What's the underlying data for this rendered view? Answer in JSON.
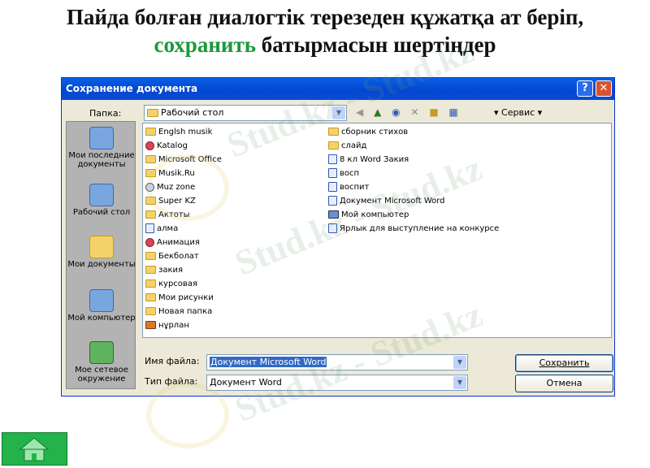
{
  "slide": {
    "title_line1": "Пайда болған диалогтік терезеден құжатқа ат беріп,",
    "title_keyword": "сохранить",
    "title_line2_rest": " батырмасын шертіңдер"
  },
  "watermark": {
    "text": "Stud.kz - Stud.kz"
  },
  "dialog": {
    "title": "Сохранение документа",
    "help_glyph": "?",
    "close_glyph": "✕",
    "folder_label": "Папка:",
    "folder_value": "Рабочий стол",
    "tools_label": "Сервис",
    "places": [
      {
        "label": "Мои последние документы"
      },
      {
        "label": "Рабочий стол"
      },
      {
        "label": "Мои документы"
      },
      {
        "label": "Мой компьютер"
      },
      {
        "label": "Мое сетевое окружение"
      }
    ],
    "files_left": [
      {
        "name": "Englsh musik",
        "icon": "folder-icon"
      },
      {
        "name": "Katalog",
        "icon": "app-icon"
      },
      {
        "name": "Microsoft Office",
        "icon": "folder-icon"
      },
      {
        "name": "Musik.Ru",
        "icon": "folder-icon"
      },
      {
        "name": "Muz zone",
        "icon": "cd-icon"
      },
      {
        "name": "Super KZ",
        "icon": "folder-icon"
      },
      {
        "name": "Актоты",
        "icon": "folder-icon"
      },
      {
        "name": "алма",
        "icon": "shortcut-icon"
      },
      {
        "name": "Анимация",
        "icon": "app-icon"
      },
      {
        "name": "Бекболат",
        "icon": "folder-icon"
      },
      {
        "name": "закия",
        "icon": "folder-icon"
      },
      {
        "name": "курсовая",
        "icon": "folder-icon"
      },
      {
        "name": "Мои рисунки",
        "icon": "folder-icon"
      },
      {
        "name": "Новая папка",
        "icon": "folder-icon"
      },
      {
        "name": "нұрлан",
        "icon": "box-icon"
      }
    ],
    "files_right": [
      {
        "name": "сборник стихов",
        "icon": "folder-icon"
      },
      {
        "name": "слайд",
        "icon": "folder-icon"
      },
      {
        "name": "8 кл Word Закия",
        "icon": "word-doc-icon"
      },
      {
        "name": "восп",
        "icon": "word-doc-icon"
      },
      {
        "name": "воспит",
        "icon": "word-doc-icon"
      },
      {
        "name": "Документ Microsoft Word",
        "icon": "word-doc-icon"
      },
      {
        "name": "Мой компьютер",
        "icon": "computer-icon"
      },
      {
        "name": "Ярлык для выступление на конкурсе",
        "icon": "shortcut-icon"
      }
    ],
    "filename_label": "Имя файла:",
    "filename_value": "Документ Microsoft Word",
    "filetype_label": "Тип файла:",
    "filetype_value": "Документ Word",
    "save_label": "Сохранить",
    "cancel_label": "Отмена"
  },
  "colors": {
    "keyword": "#1a9a3a",
    "titlebar": "#0347cf",
    "home_button": "#23b34a"
  }
}
